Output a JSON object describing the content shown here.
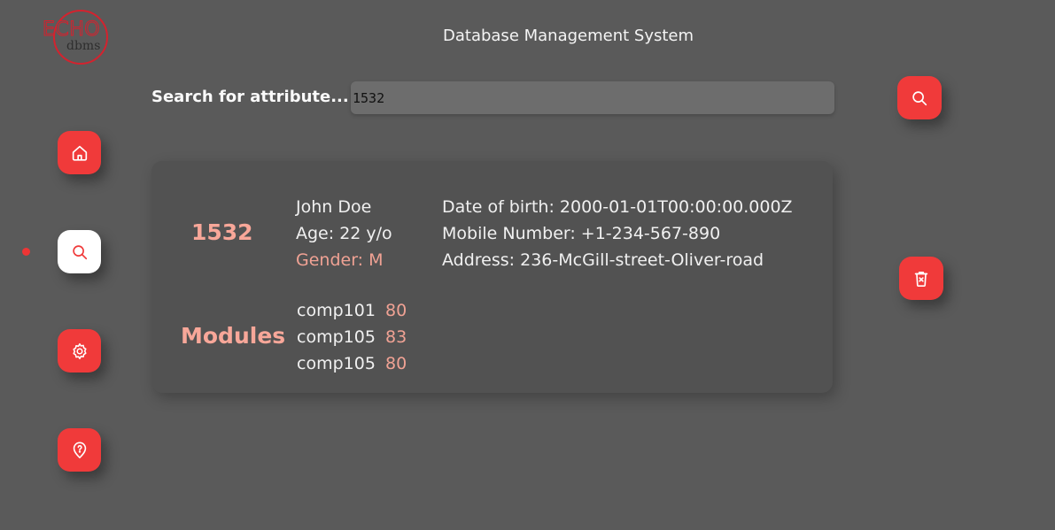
{
  "logo": {
    "main_text": "ECHO",
    "sub_text": "dbms"
  },
  "header": {
    "title": "Database Management System"
  },
  "sidebar": {
    "items": [
      {
        "icon": "home-icon",
        "active": false
      },
      {
        "icon": "search-icon",
        "active": true
      },
      {
        "icon": "gear-icon",
        "active": false
      },
      {
        "icon": "help-pin-icon",
        "active": false
      }
    ]
  },
  "search": {
    "label": "Search for attribute...",
    "value": "1532",
    "button_icon": "search-icon"
  },
  "record": {
    "id": "1532",
    "name": "John Doe",
    "age": "Age: 22 y/o",
    "gender": "Gender: M",
    "dob": "Date of birth: 2000-01-01T00:00:00.000Z",
    "mobile": "Mobile Number: +1-234-567-890",
    "address": "Address: 236-McGill-street-Oliver-road",
    "modules_heading": "Modules",
    "modules": [
      {
        "code": "comp101",
        "grade": "80"
      },
      {
        "code": "comp105",
        "grade": "83"
      },
      {
        "code": "comp105",
        "grade": "80"
      }
    ]
  },
  "actions": {
    "delete_icon": "delete-icon"
  },
  "colors": {
    "background": "#5a5a5a",
    "card": "#525252",
    "accent_red": "#f03a3a",
    "accent_salmon": "#f8a799"
  }
}
